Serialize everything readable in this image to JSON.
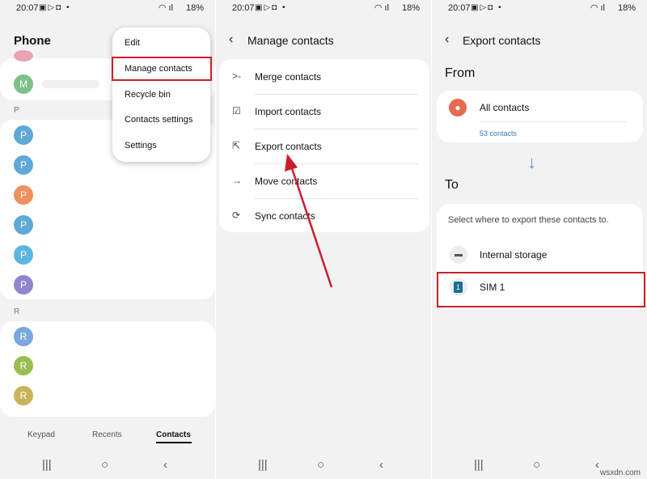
{
  "status": {
    "time": "20:07",
    "battery": "18%"
  },
  "screen1": {
    "title": "Phone",
    "section_p": "P",
    "section_r": "R",
    "avatar_m": "M",
    "avatar_p": "P",
    "avatar_r": "R",
    "menu": [
      "Edit",
      "Manage contacts",
      "Recycle bin",
      "Contacts settings",
      "Settings"
    ],
    "tabs": [
      "Keypad",
      "Recents",
      "Contacts"
    ]
  },
  "screen2": {
    "title": "Manage contacts",
    "items": [
      "Merge contacts",
      "Import contacts",
      "Export contacts",
      "Move contacts",
      "Sync contacts"
    ]
  },
  "screen3": {
    "title": "Export contacts",
    "from_label": "From",
    "source_name": "All contacts",
    "source_count": "53 contacts",
    "to_label": "To",
    "prompt": "Select where to export these contacts to.",
    "dest_internal": "Internal storage",
    "dest_sim": "SIM 1",
    "sim_badge": "1"
  },
  "watermark": "wsxdn.com",
  "colors": {
    "highlight": "#c8202a",
    "avatar_p": "#5ea9d6",
    "avatar_r": "#9bbc52",
    "avatar_m": "#7cc08a",
    "avatar_orange": "#f0905e",
    "avatar_purple": "#8f86cf",
    "contact_icon": "#e86a4e"
  }
}
